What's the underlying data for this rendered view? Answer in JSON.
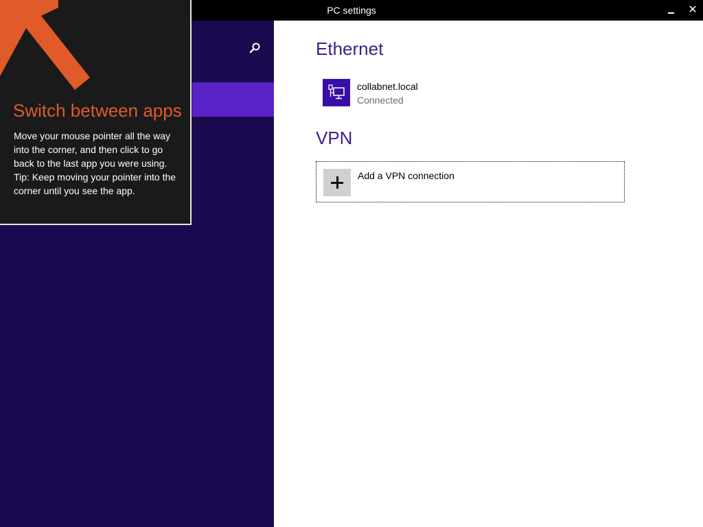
{
  "window": {
    "title": "PC settings",
    "minimize_icon": "minimize-icon",
    "close_glyph": "✕"
  },
  "leftpane": {
    "search_icon": "search-icon",
    "background": "#1b0a4f",
    "selected_color": "#5a23c8"
  },
  "ethernet": {
    "heading": "Ethernet",
    "network": {
      "name": "collabnet.local",
      "status": "Connected",
      "icon": "network-icon"
    }
  },
  "vpn": {
    "heading": "VPN",
    "add_label": "Add a VPN connection",
    "add_icon": "plus-icon"
  },
  "tip": {
    "title": "Switch between apps",
    "body": "Move your mouse pointer all the way into the corner, and then click to go back to the last app you were using.",
    "hint": "Tip: Keep moving your pointer into the corner until you see the app.",
    "arrow_icon": "arrow-icon",
    "accent": "#e05a2a"
  },
  "colors": {
    "heading": "#3e1e8c",
    "tile": "#3a0ca8"
  }
}
